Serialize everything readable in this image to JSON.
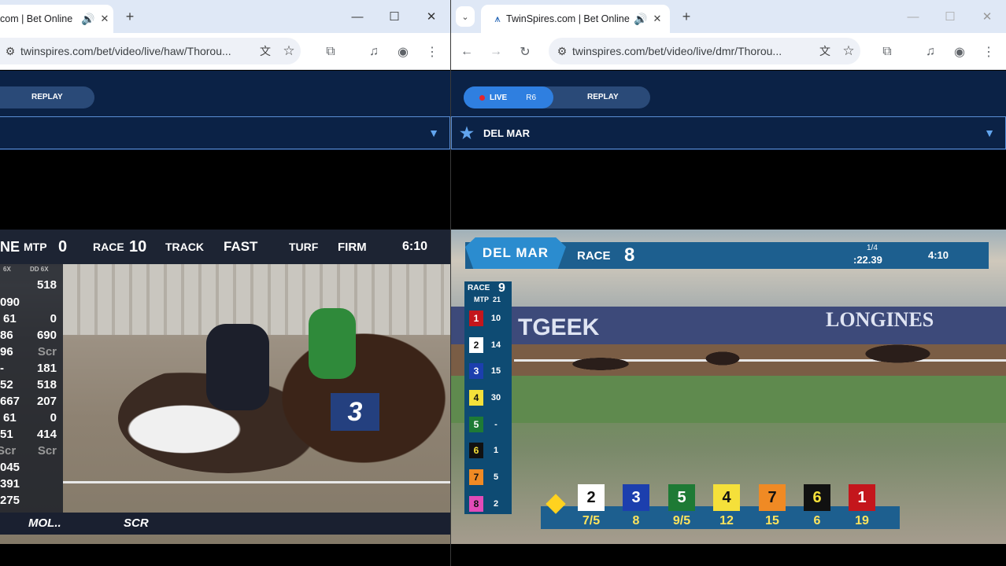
{
  "left_window": {
    "tab": {
      "title": "com | Bet Online",
      "audio_icon": "speaker-icon",
      "close": "✕"
    },
    "new_tab": "+",
    "controls": {
      "minimize": "—",
      "maximize": "☐",
      "close": "✕"
    },
    "url": "twinspires.com/bet/video/live/haw/Thorou...",
    "site": {
      "replay_label": "REPLAY"
    },
    "video": {
      "topbar": {
        "ne": "NE",
        "mtp_label": "MTP",
        "mtp": "0",
        "race_label": "RACE",
        "race": "10",
        "track_label": "TRACK",
        "track": "FAST",
        "turf_label": "TURF",
        "turf": "FIRM",
        "time": "6:10"
      },
      "col_heads": [
        "6X",
        "DD 6X"
      ],
      "rows": [
        {
          "a": "",
          "b": "518"
        },
        {
          "a": "090",
          "b": ""
        },
        {
          "a": "61",
          "b": "0"
        },
        {
          "a": "86",
          "b": "690"
        },
        {
          "a": "96",
          "b": "Scr"
        },
        {
          "a": "-",
          "b": "181"
        },
        {
          "a": "52",
          "b": "518"
        },
        {
          "a": "667",
          "b": "207"
        },
        {
          "a": "61",
          "b": "0"
        },
        {
          "a": "51",
          "b": "414"
        },
        {
          "a": "Scr",
          "b": "Scr"
        },
        {
          "a": "045",
          "b": ""
        },
        {
          "a": "391",
          "b": ""
        },
        {
          "a": "275",
          "b": ""
        }
      ],
      "saddle_number": "3",
      "bottom": {
        "mol": "MOL..",
        "scr": "SCR"
      }
    }
  },
  "right_window": {
    "tab": {
      "title": "TwinSpires.com | Bet Online",
      "audio_icon": "speaker-icon",
      "close": "✕"
    },
    "new_tab": "+",
    "controls": {
      "minimize": "—",
      "maximize": "☐",
      "close": "✕"
    },
    "url": "twinspires.com/bet/video/live/dmr/Thorou...",
    "site": {
      "live_label": "LIVE",
      "race_short": "R6",
      "replay_label": "REPLAY",
      "track_name": "DEL MAR"
    },
    "video": {
      "logo": "DEL MAR",
      "race_label": "RACE",
      "race": "8",
      "fraction": "1/4",
      "split": ":22.39",
      "clock": "4:10",
      "sponsors": [
        "TGEEK",
        "LONGINES"
      ],
      "side": {
        "race_label": "RACE",
        "race": "9",
        "mtp_label": "MTP",
        "mtp": "21",
        "programs": [
          {
            "num": "1",
            "val": "10",
            "bg": "#c4161c",
            "fg": "#ffffff"
          },
          {
            "num": "2",
            "val": "14",
            "bg": "#ffffff",
            "fg": "#111111"
          },
          {
            "num": "3",
            "val": "15",
            "bg": "#1c3fae",
            "fg": "#ffffff"
          },
          {
            "num": "4",
            "val": "30",
            "bg": "#f5e03a",
            "fg": "#111111"
          },
          {
            "num": "5",
            "val": "-",
            "bg": "#1e7a35",
            "fg": "#ffffff"
          },
          {
            "num": "6",
            "val": "1",
            "bg": "#111111",
            "fg": "#f5e03a"
          },
          {
            "num": "7",
            "val": "5",
            "bg": "#f08a24",
            "fg": "#111111"
          },
          {
            "num": "8",
            "val": "2",
            "bg": "#e24bb8",
            "fg": "#111111"
          }
        ]
      },
      "order": [
        {
          "num": "2",
          "odds": "7/5",
          "bg": "#ffffff",
          "fg": "#111111"
        },
        {
          "num": "3",
          "odds": "8",
          "bg": "#1c3fae",
          "fg": "#ffffff"
        },
        {
          "num": "5",
          "odds": "9/5",
          "bg": "#1e7a35",
          "fg": "#ffffff"
        },
        {
          "num": "4",
          "odds": "12",
          "bg": "#f5e03a",
          "fg": "#111111"
        },
        {
          "num": "7",
          "odds": "15",
          "bg": "#f08a24",
          "fg": "#111111"
        },
        {
          "num": "6",
          "odds": "6",
          "bg": "#111111",
          "fg": "#f5e03a"
        },
        {
          "num": "1",
          "odds": "19",
          "bg": "#c4161c",
          "fg": "#ffffff"
        }
      ]
    }
  }
}
